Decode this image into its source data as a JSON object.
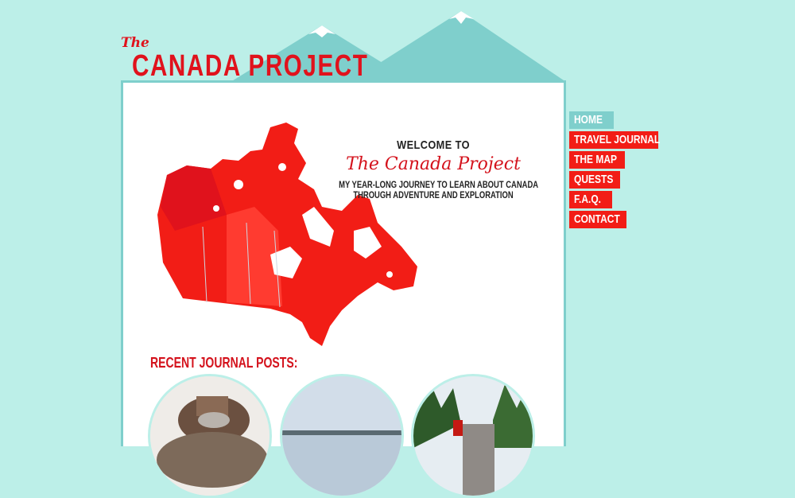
{
  "logo": {
    "the": "The",
    "name": "CANADA PROJECT"
  },
  "welcome": {
    "heading": "WELCOME TO",
    "title": "The Canada Project",
    "subtitle_line1": "MY YEAR-LONG JOURNEY TO LEARN ABOUT CANADA",
    "subtitle_line2": "THROUGH ADVENTURE AND EXPLORATION"
  },
  "recent": {
    "heading": "RECENT JOURNAL POSTS:"
  },
  "nav": {
    "items": [
      {
        "label": "HOME",
        "color": "#7fcfcc"
      },
      {
        "label": "TRAVEL JOURNAL",
        "color": "#f21d16"
      },
      {
        "label": "THE MAP",
        "color": "#f21d16"
      },
      {
        "label": "QUESTS",
        "color": "#f21d16"
      },
      {
        "label": "F.A.Q.",
        "color": "#f21d16"
      },
      {
        "label": "CONTACT",
        "color": "#f21d16"
      }
    ]
  },
  "colors": {
    "background": "#bcefe8",
    "accent": "#e0121c",
    "mountain": "#7fcfcc"
  }
}
